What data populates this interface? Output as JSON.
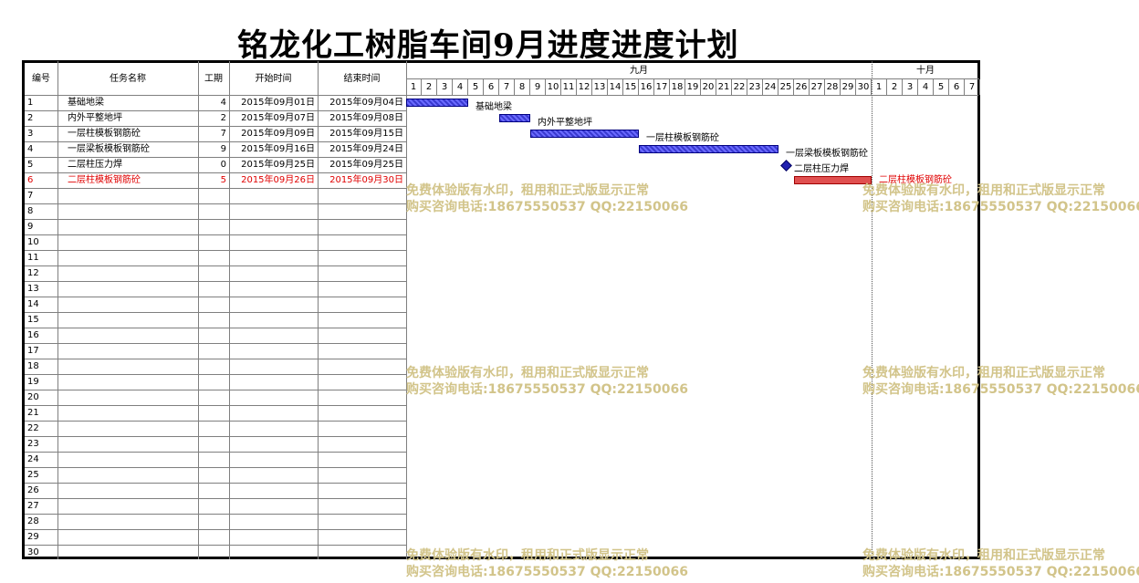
{
  "title": "铭龙化工树脂车间9月进度进度计划",
  "headers": {
    "no": "编号",
    "name": "任务名称",
    "duration": "工期",
    "start": "开始时间",
    "end": "结束时间"
  },
  "months": [
    {
      "label": "九月"
    },
    {
      "label": "十月"
    }
  ],
  "days_sep": [
    "1",
    "2",
    "3",
    "4",
    "5",
    "6",
    "7",
    "8",
    "9",
    "10",
    "11",
    "12",
    "13",
    "14",
    "15",
    "16",
    "17",
    "18",
    "19",
    "20",
    "21",
    "22",
    "23",
    "24",
    "25",
    "26",
    "27",
    "28",
    "29",
    "30"
  ],
  "days_oct": [
    "1",
    "2",
    "3",
    "4",
    "5",
    "6",
    "7"
  ],
  "tasks": [
    {
      "no": "1",
      "name": "基础地梁",
      "duration": "4",
      "start": "2015年09月01日",
      "end": "2015年09月04日",
      "highlight": false,
      "bar_start_day": 1,
      "bar_end_day": 4,
      "milestone": false,
      "bar_color": "#3a3ad0"
    },
    {
      "no": "2",
      "name": "内外平整地坪",
      "duration": "2",
      "start": "2015年09月07日",
      "end": "2015年09月08日",
      "highlight": false,
      "bar_start_day": 7,
      "bar_end_day": 8,
      "milestone": false,
      "bar_color": "#3a3ad0"
    },
    {
      "no": "3",
      "name": "一层柱模板钢筋砼",
      "duration": "7",
      "start": "2015年09月09日",
      "end": "2015年09月15日",
      "highlight": false,
      "bar_start_day": 9,
      "bar_end_day": 15,
      "milestone": false,
      "bar_color": "#3a3ad0"
    },
    {
      "no": "4",
      "name": "一层梁板模板钢筋砼",
      "duration": "9",
      "start": "2015年09月16日",
      "end": "2015年09月24日",
      "highlight": false,
      "bar_start_day": 16,
      "bar_end_day": 24,
      "milestone": false,
      "bar_color": "#3a3ad0"
    },
    {
      "no": "5",
      "name": "二层柱压力焊",
      "duration": "0",
      "start": "2015年09月25日",
      "end": "2015年09月25日",
      "highlight": false,
      "bar_start_day": 25,
      "bar_end_day": 25,
      "milestone": true,
      "bar_color": "#2020b0"
    },
    {
      "no": "6",
      "name": "二层柱模板钢筋砼",
      "duration": "5",
      "start": "2015年09月26日",
      "end": "2015年09月30日",
      "highlight": true,
      "bar_start_day": 26,
      "bar_end_day": 30,
      "milestone": false,
      "bar_color": "#e05050"
    }
  ],
  "empty_rows": [
    "7",
    "8",
    "9",
    "10",
    "11",
    "12",
    "13",
    "14",
    "15",
    "16",
    "17",
    "18",
    "19",
    "20",
    "21",
    "22",
    "23",
    "24",
    "25",
    "26",
    "27",
    "28",
    "29",
    "30"
  ],
  "watermark": {
    "line1": "免费体验版有水印，租用和正式版显示正常",
    "line2": "购买咨询电话:18675550537 QQ:22150066"
  },
  "colors": {
    "highlight_text": "#e00000",
    "watermark": "#d2c48a"
  }
}
